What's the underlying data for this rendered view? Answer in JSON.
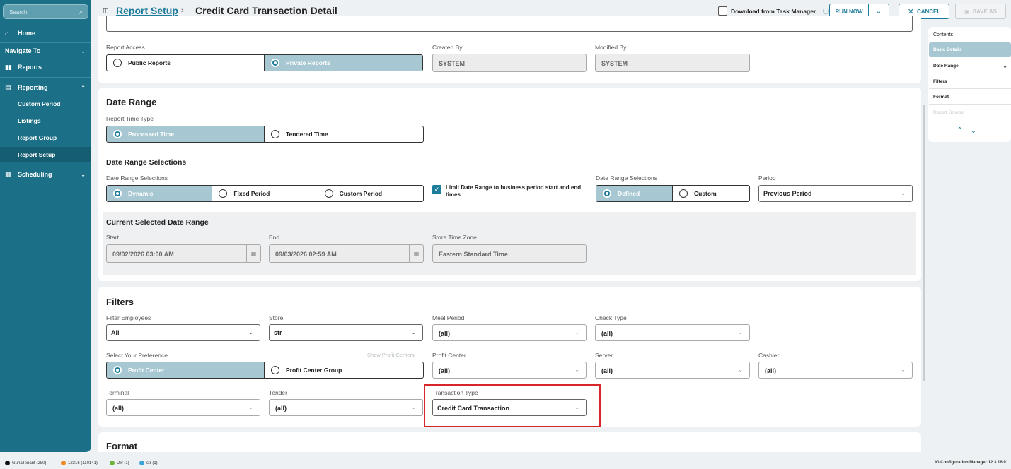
{
  "sidebar": {
    "search_placeholder": "Search",
    "home": "Home",
    "navigate_to": "Navigate To",
    "reports": "Reports",
    "reporting": "Reporting",
    "reporting_items": [
      "Custom Period",
      "Listings",
      "Report Group",
      "Report Setup"
    ],
    "active_item": "Report Setup",
    "scheduling": "Scheduling"
  },
  "header": {
    "breadcrumb_link": "Report Setup",
    "title": "Credit Card Transaction Detail",
    "download_label": "Download from Task Manager",
    "run_now": "RUN NOW",
    "cancel": "CANCEL",
    "save_as": "SAVE AS"
  },
  "basic": {
    "report_access_label": "Report Access",
    "public_reports": "Public Reports",
    "private_reports": "Private Reports",
    "created_by_label": "Created By",
    "created_by": "SYSTEM",
    "modified_by_label": "Modified By",
    "modified_by": "SYSTEM"
  },
  "date_range": {
    "heading": "Date Range",
    "time_type_label": "Report Time Type",
    "processed_time": "Processed Time",
    "tendered_time": "Tendered Time",
    "selections_heading": "Date Range Selections",
    "selections_label": "Date Range Selections",
    "dynamic": "Dynamic",
    "fixed_period": "Fixed Period",
    "custom_period": "Custom Period",
    "limit_label": "Limit Date Range to business period start and end times",
    "selections_label_2": "Date Range Selections",
    "defined": "Defined",
    "custom": "Custom",
    "period_label": "Period",
    "period_value": "Previous Period",
    "current_heading": "Current Selected Date Range",
    "start_label": "Start",
    "start_value": "09/02/2026 03:00 AM",
    "end_label": "End",
    "end_value": "09/03/2026 02:59 AM",
    "tz_label": "Store Time Zone",
    "tz_value": "Eastern Standard Time"
  },
  "filters": {
    "heading": "Filters",
    "filter_employees_label": "Filter Employees",
    "filter_employees": "All",
    "store_label": "Store",
    "store": "str",
    "meal_period_label": "Meal Period",
    "meal_period": "(all)",
    "check_type_label": "Check Type",
    "check_type": "(all)",
    "preference_label": "Select Your Preference",
    "show_profit_centers": "Show Profit Centers",
    "profit_center_opt": "Profit Center",
    "profit_center_group_opt": "Profit Center Group",
    "profit_center_label": "Profit Center",
    "profit_center": "(all)",
    "server_label": "Server",
    "server": "(all)",
    "cashier_label": "Cashier",
    "cashier": "(all)",
    "terminal_label": "Terminal",
    "terminal": "(all)",
    "tender_label": "Tender",
    "tender": "(all)",
    "transaction_type_label": "Transaction Type",
    "transaction_type": "Credit Card Transaction"
  },
  "format": {
    "heading": "Format"
  },
  "contents": {
    "title": "Contents",
    "items": [
      "Basic Details",
      "Date Range",
      "Filters",
      "Format",
      "Report Groups"
    ]
  },
  "status": {
    "tenant": "GunaTenant (280)",
    "enterprise": "12316 (110141)",
    "div": "Div (1)",
    "store": "str (1)",
    "version": "IG Configuration Manager 12.3.16.91"
  },
  "colors": {
    "accent": "#1e7d9a",
    "sidebar": "#1b6f86",
    "selected": "#a7c8d2",
    "highlight": "#d7262a"
  }
}
